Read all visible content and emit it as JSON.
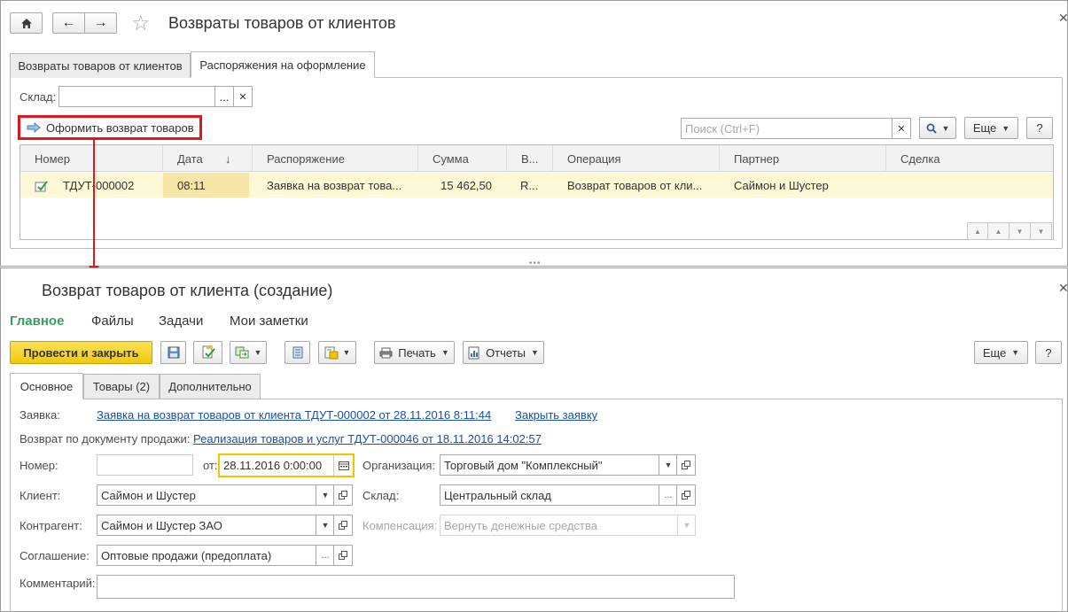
{
  "top": {
    "title": "Возвраты товаров от клиентов",
    "tabs": [
      "Возвраты товаров от клиентов",
      "Распоряжения на оформление"
    ],
    "warehouse_label": "Склад:",
    "warehouse_value": "",
    "create_return_button": "Оформить возврат товаров",
    "search_placeholder": "Поиск (Ctrl+F)",
    "more_button": "Еще",
    "help_button": "?",
    "table": {
      "columns": [
        "Номер",
        "Дата",
        "Распоряжение",
        "Сумма",
        "В...",
        "Операция",
        "Партнер",
        "Сделка"
      ],
      "rows": [
        {
          "number": "ТДУТ-000002",
          "date": "08:11",
          "order": "Заявка на возврат това...",
          "sum": "15 462,50",
          "currency": "R...",
          "operation": "Возврат товаров от кли...",
          "partner": "Саймон и Шустер",
          "deal": ""
        }
      ]
    }
  },
  "bottom": {
    "title": "Возврат товаров от клиента (создание)",
    "nav": [
      "Главное",
      "Файлы",
      "Задачи",
      "Мои заметки"
    ],
    "post_close_button": "Провести и закрыть",
    "print_button": "Печать",
    "reports_button": "Отчеты",
    "more_button": "Еще",
    "help_button": "?",
    "tabs": [
      "Основное",
      "Товары (2)",
      "Дополнительно"
    ],
    "request_label": "Заявка:",
    "request_link": "Заявка на возврат товаров от клиента ТДУТ-000002 от 28.11.2016 8:11:44",
    "close_request_link": "Закрыть заявку",
    "sale_doc_label": "Возврат по документу продажи:",
    "sale_doc_link": "Реализация товаров и услуг ТДУТ-000046 от 18.11.2016 14:02:57",
    "number_label": "Номер:",
    "number_value": "",
    "date_label": "от:",
    "date_value": "28.11.2016  0:00:00",
    "org_label": "Организация:",
    "org_value": "Торговый дом \"Комплексный\"",
    "client_label": "Клиент:",
    "client_value": "Саймон и Шустер",
    "warehouse_label": "Склад:",
    "warehouse_value": "Центральный склад",
    "contractor_label": "Контрагент:",
    "contractor_value": "Саймон и Шустер ЗАО",
    "compensation_label": "Компенсация:",
    "compensation_value": "Вернуть денежные средства",
    "agreement_label": "Соглашение:",
    "agreement_value": "Оптовые продажи (предоплата)",
    "comment_label": "Комментарий:",
    "comment_value": ""
  },
  "colors": {
    "accent_green": "#3d9b5e",
    "primary_yellow": "#f5d21f",
    "highlight_red": "#e0181b",
    "link_blue": "#1a50a5",
    "row_selected": "#fdf8d5"
  }
}
